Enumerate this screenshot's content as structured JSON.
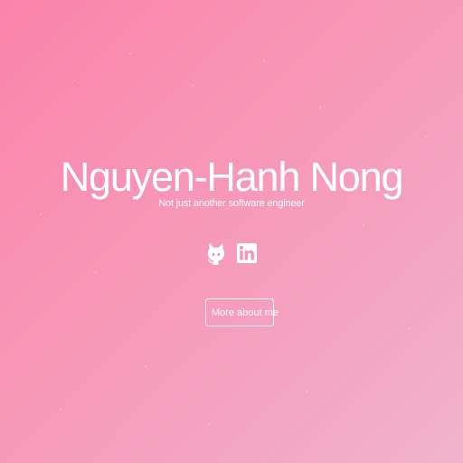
{
  "hero": {
    "name": "Nguyen-Hanh Nong",
    "tagline": "Not just another software engineer",
    "cta_label": "More about me"
  },
  "social_links": [
    {
      "icon": "github-icon",
      "label": "GitHub"
    },
    {
      "icon": "linkedin-icon",
      "label": "LinkedIn"
    }
  ],
  "colors": {
    "background_start": "#fb84ab",
    "background_end": "#f0b3cc",
    "text": "#ffffff"
  }
}
